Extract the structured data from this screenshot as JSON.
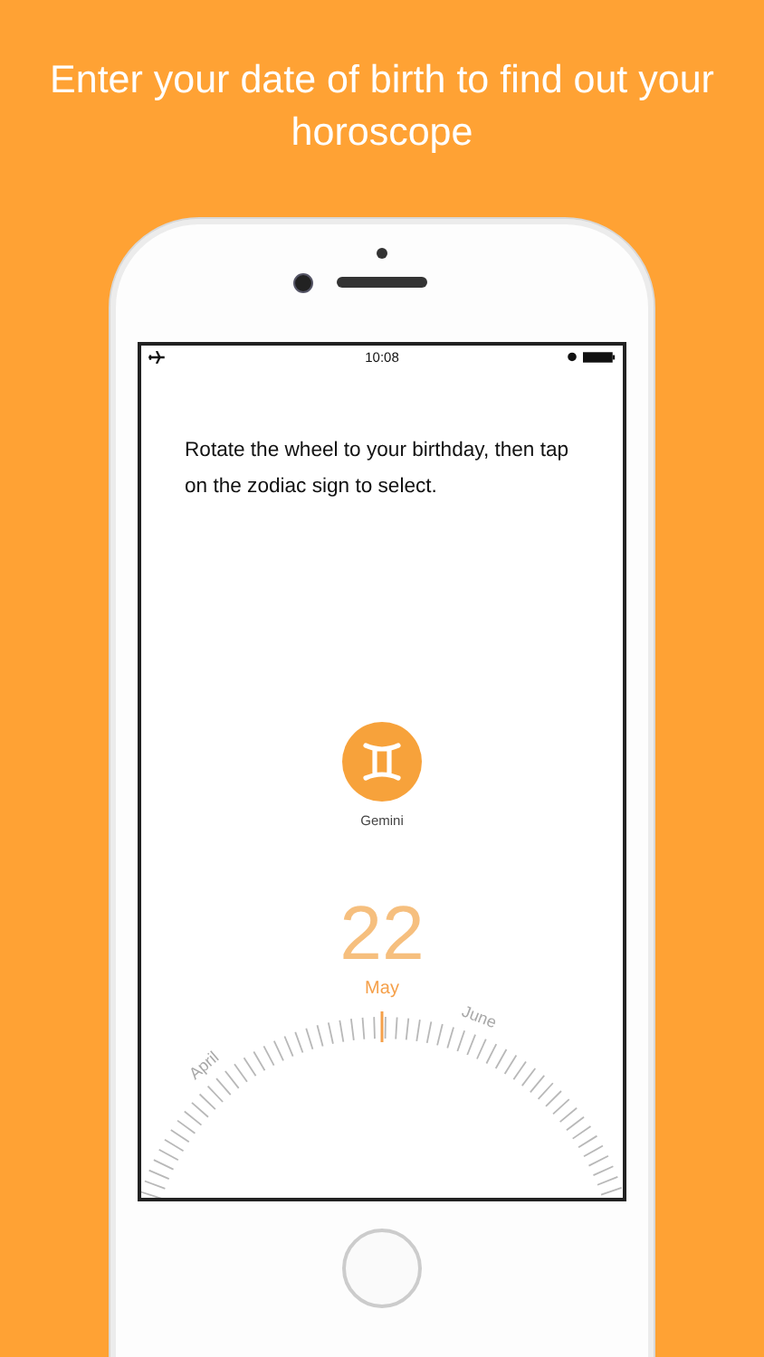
{
  "headline": "Enter your date of birth to find out your horoscope",
  "status_bar": {
    "time": "10:08"
  },
  "instruction": "Rotate the wheel to your birthday, then tap on the zodiac sign to select.",
  "sign": {
    "name": "Gemini"
  },
  "day": "22",
  "months": [
    {
      "label": "April",
      "selected": false
    },
    {
      "label": "May",
      "selected": true
    },
    {
      "label": "June",
      "selected": false
    }
  ]
}
